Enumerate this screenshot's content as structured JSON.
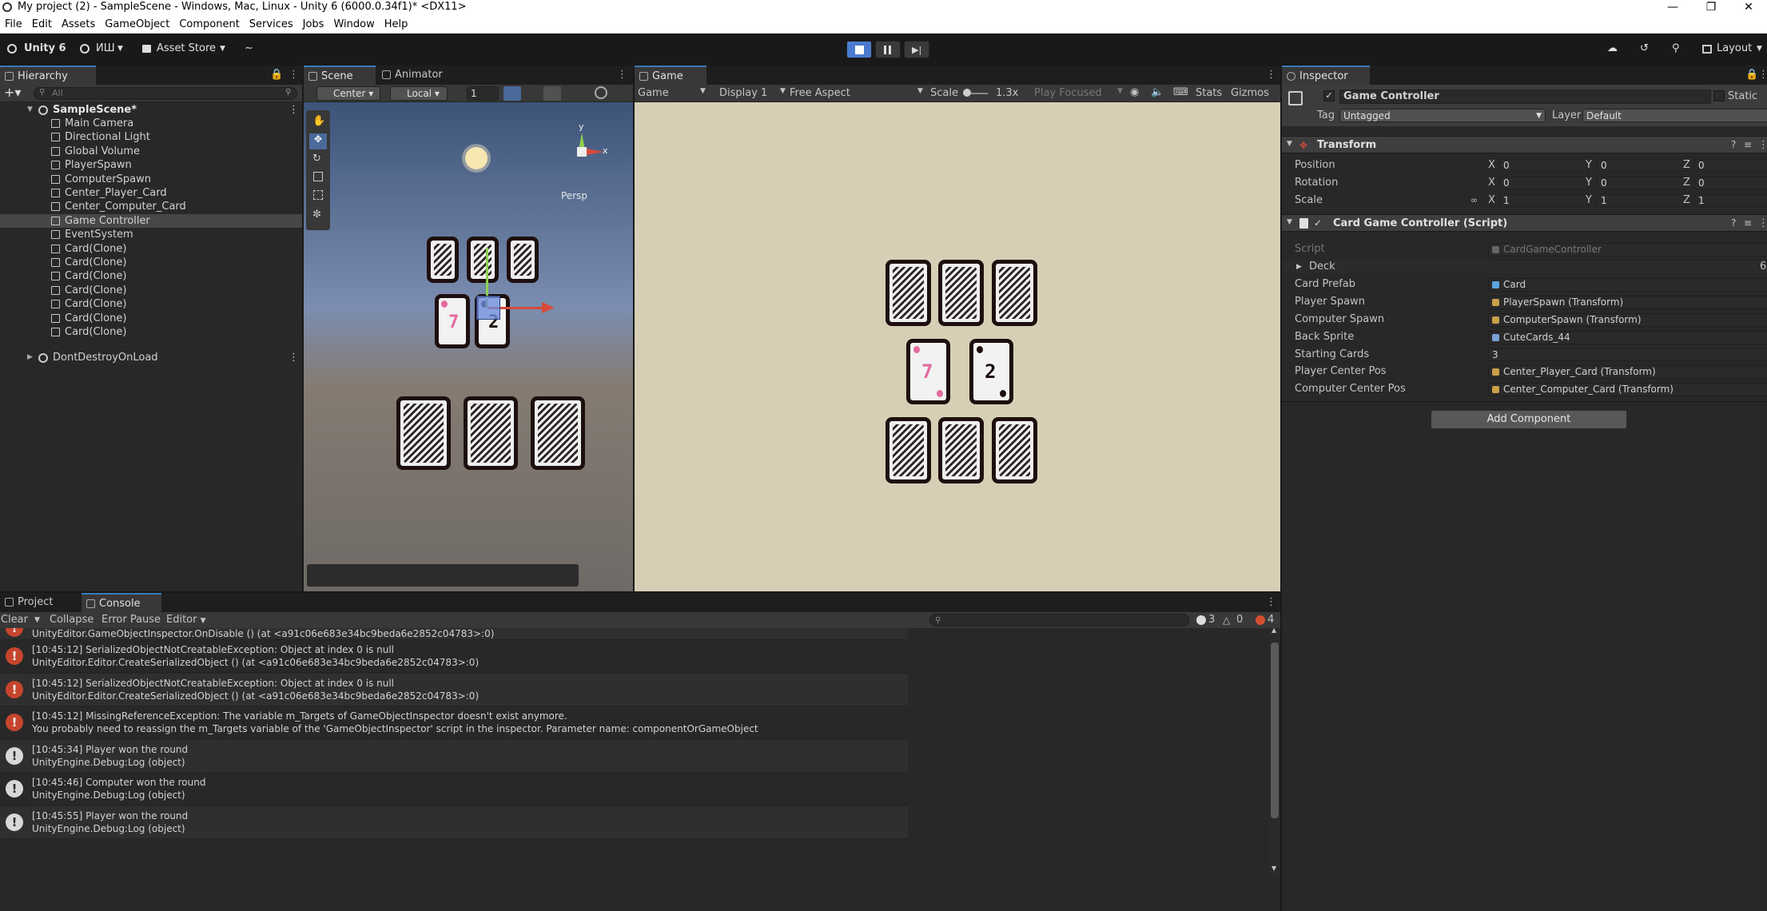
{
  "window": {
    "title": "My project (2) - SampleScene - Windows, Mac, Linux - Unity 6 (6000.0.34f1)* <DX11>"
  },
  "menu": [
    "File",
    "Edit",
    "Assets",
    "GameObject",
    "Component",
    "Services",
    "Jobs",
    "Window",
    "Help"
  ],
  "toolbar": {
    "unity_label": "Unity 6",
    "account": "ИШ",
    "asset_store": "Asset Store",
    "layout": "Layout"
  },
  "hierarchy": {
    "tab": "Hierarchy",
    "search_placeholder": "All",
    "scene": "SampleScene*",
    "items": [
      "Main Camera",
      "Directional Light",
      "Global Volume",
      "PlayerSpawn",
      "ComputerSpawn",
      "Center_Player_Card",
      "Center_Computer_Card",
      "Game Controller",
      "EventSystem",
      "Card(Clone)",
      "Card(Clone)",
      "Card(Clone)",
      "Card(Clone)",
      "Card(Clone)",
      "Card(Clone)",
      "Card(Clone)"
    ],
    "selected_index": 7,
    "dont_destroy": "DontDestroyOnLoad"
  },
  "scene": {
    "tab": "Scene",
    "animator_tab": "Animator",
    "pivot": "Center",
    "space": "Local",
    "grid_value": "1",
    "persp": "Persp",
    "axis_x": "x",
    "axis_y": "y"
  },
  "game": {
    "tab": "Game",
    "mode": "Game",
    "display": "Display 1",
    "aspect": "Free Aspect",
    "scale_label": "Scale",
    "scale_value": "1.3x",
    "play_focused": "Play Focused",
    "stats": "Stats",
    "gizmos": "Gizmos",
    "player_card": "7",
    "computer_card": "2"
  },
  "inspector": {
    "tab": "Inspector",
    "object_name": "Game Controller",
    "static": "Static",
    "tag_label": "Tag",
    "tag_value": "Untagged",
    "layer_label": "Layer",
    "layer_value": "Default",
    "transform": {
      "title": "Transform",
      "position_label": "Position",
      "rotation_label": "Rotation",
      "scale_label": "Scale",
      "position": [
        "0",
        "0",
        "0"
      ],
      "rotation": [
        "0",
        "0",
        "0"
      ],
      "scale": [
        "1",
        "1",
        "1"
      ]
    },
    "script_comp": {
      "title": "Card Game Controller (Script)",
      "script_label": "Script",
      "script_value": "CardGameController",
      "deck_label": "Deck",
      "deck_count": "6",
      "card_prefab_label": "Card Prefab",
      "card_prefab": "Card",
      "player_spawn_label": "Player Spawn",
      "player_spawn": "PlayerSpawn (Transform)",
      "computer_spawn_label": "Computer Spawn",
      "computer_spawn": "ComputerSpawn (Transform)",
      "back_sprite_label": "Back Sprite",
      "back_sprite": "CuteCards_44",
      "starting_cards_label": "Starting Cards",
      "starting_cards": "3",
      "player_center_label": "Player Center Pos",
      "player_center": "Center_Player_Card (Transform)",
      "computer_center_label": "Computer Center Pos",
      "computer_center": "Center_Computer_Card (Transform)"
    },
    "add_component": "Add Component"
  },
  "console": {
    "project_tab": "Project",
    "console_tab": "Console",
    "clear": "Clear",
    "collapse": "Collapse",
    "error_pause": "Error Pause",
    "editor": "Editor",
    "count_log": "3",
    "count_warn": "0",
    "count_err": "4",
    "partial": "UnityEditor.GameObjectInspector.OnDisable () (at <a91c06e683e34bc9beda6e2852c04783>:0)",
    "rows": [
      {
        "type": "error",
        "l1": "[10:45:12] SerializedObjectNotCreatableException: Object at index 0 is null",
        "l2": "UnityEditor.Editor.CreateSerializedObject () (at <a91c06e683e34bc9beda6e2852c04783>:0)"
      },
      {
        "type": "error",
        "l1": "[10:45:12] SerializedObjectNotCreatableException: Object at index 0 is null",
        "l2": "UnityEditor.Editor.CreateSerializedObject () (at <a91c06e683e34bc9beda6e2852c04783>:0)"
      },
      {
        "type": "error",
        "l1": "[10:45:12] MissingReferenceException: The variable m_Targets of GameObjectInspector doesn't exist anymore.",
        "l2": "You probably need to reassign the m_Targets variable of the 'GameObjectInspector' script in the inspector. Parameter name: componentOrGameObject"
      },
      {
        "type": "log",
        "l1": "[10:45:34] Player won the round",
        "l2": "UnityEngine.Debug:Log (object)"
      },
      {
        "type": "log",
        "l1": "[10:45:46] Computer won the round",
        "l2": "UnityEngine.Debug:Log (object)"
      },
      {
        "type": "log",
        "l1": "[10:45:55] Player won the round",
        "l2": "UnityEngine.Debug:Log (object)"
      }
    ]
  },
  "colors": {
    "accent": "#3a79bb",
    "error": "#c6462d",
    "game_bg": "#d6cfb5"
  }
}
